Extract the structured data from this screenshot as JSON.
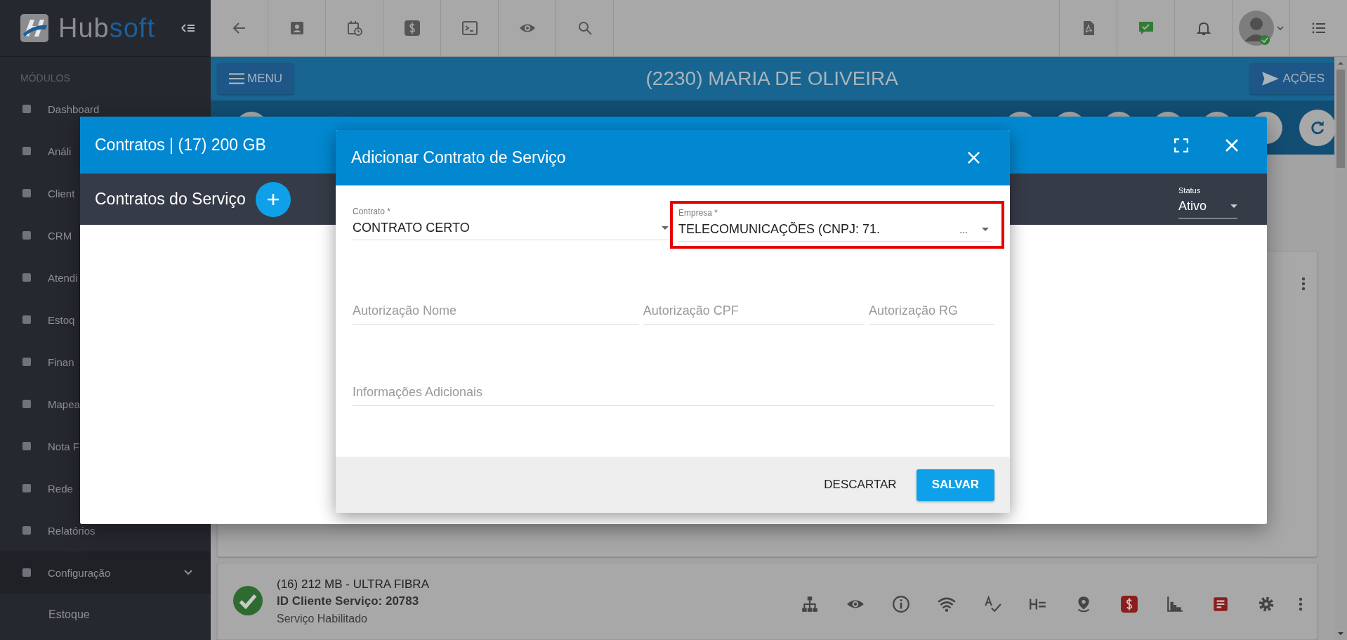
{
  "sidebar": {
    "logo": {
      "part_1": "Hub",
      "part_2": "soft"
    },
    "section": "MÓDULOS",
    "items": [
      {
        "label": "Dashboard"
      },
      {
        "label": "Análi"
      },
      {
        "label": "Client"
      },
      {
        "label": "CRM"
      },
      {
        "label": "Atendi"
      },
      {
        "label": "Estoq"
      },
      {
        "label": "Finan"
      },
      {
        "label": "Mapea"
      },
      {
        "label": "Nota F"
      },
      {
        "label": "Rede"
      },
      {
        "label": "Relatórios"
      },
      {
        "label": "Configuração",
        "expanded": true,
        "children": [
          {
            "label": "Estoque"
          }
        ]
      }
    ]
  },
  "client_bar": {
    "menu_button": "MENU",
    "title": "(2230) MARIA DE OLIVEIRA",
    "actions_button": "AÇÕES"
  },
  "services": [
    {
      "title": "(16) 212 MB - ULTRA FIBRA",
      "id": "ID Cliente Serviço: 20783",
      "status": "Serviço Habilitado"
    }
  ],
  "contracts_modal": {
    "title": "Contratos | (17) 200 GB",
    "subtitle": "Contratos do Serviço",
    "status": {
      "label": "Status",
      "value": "Ativo"
    }
  },
  "dialog": {
    "title": "Adicionar Contrato de Serviço",
    "rows": [
      [
        {
          "kind": "select",
          "label": "Contrato *",
          "value": "CONTRATO CERTO",
          "highlighted": false
        },
        {
          "kind": "select",
          "label": "Empresa *",
          "value": "TELECOMUNICAÇÕES (CNPJ: 71.",
          "suffix": "...",
          "highlighted": true
        }
      ],
      [
        {
          "kind": "text",
          "placeholder": "Autorização Nome",
          "highlighted": false
        },
        {
          "kind": "text",
          "placeholder": "Autorização CPF",
          "highlighted": false
        },
        {
          "kind": "text",
          "placeholder": "Autorização RG",
          "highlighted": false
        }
      ],
      [
        {
          "kind": "text",
          "placeholder": "Informações Adicionais",
          "highlighted": false
        }
      ]
    ],
    "buttons": [
      {
        "label": "DESCARTAR",
        "kind": "flat"
      },
      {
        "label": "SALVAR",
        "kind": "raised"
      }
    ]
  }
}
